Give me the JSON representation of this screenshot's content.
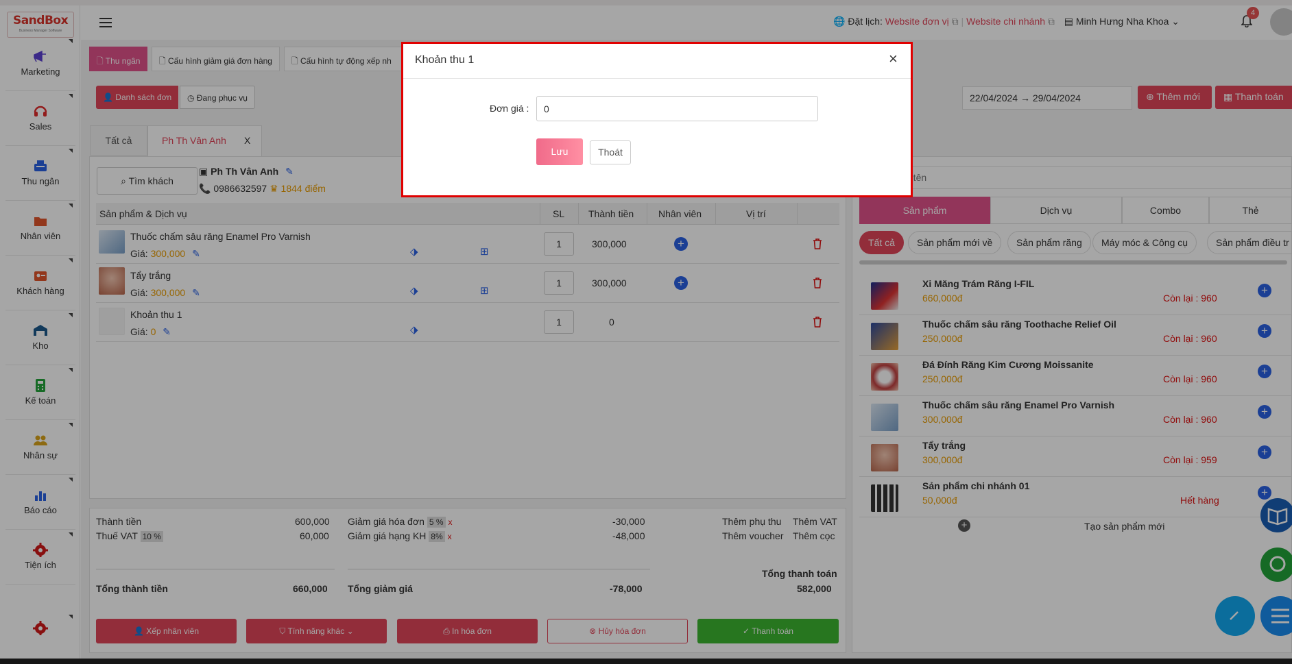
{
  "app": {
    "logo_main": "SandBox",
    "logo_sub": "Business Manager Software"
  },
  "sidebar": {
    "items": [
      {
        "label": "Marketing",
        "icon": "megaphone-icon",
        "color": "#5b3fd1"
      },
      {
        "label": "Sales",
        "icon": "headset-icon",
        "color": "#e02b2b"
      },
      {
        "label": "Thu ngân",
        "icon": "cash-register-icon",
        "color": "#2a61e4"
      },
      {
        "label": "Nhân viên",
        "icon": "folder-icon",
        "color": "#e0552b"
      },
      {
        "label": "Khách hàng",
        "icon": "contact-card-icon",
        "color": "#e0552b"
      },
      {
        "label": "Kho",
        "icon": "warehouse-icon",
        "color": "#1d5a8c"
      },
      {
        "label": "Kế toán",
        "icon": "calculator-icon",
        "color": "#22a33a"
      },
      {
        "label": "Nhân sự",
        "icon": "people-icon",
        "color": "#d9a31b"
      },
      {
        "label": "Báo cáo",
        "icon": "bar-chart-icon",
        "color": "#2a61e4"
      },
      {
        "label": "Tiện ích",
        "icon": "gear-icon",
        "color": "#d11a1a"
      }
    ]
  },
  "header": {
    "booking_label": "Đặt lịch:",
    "website_unit": "Website đơn vị",
    "website_branch": "Website chi nhánh",
    "branch_name": "Minh Hưng Nha Khoa",
    "notification_count": "4"
  },
  "tabs": {
    "cashier": "Thu ngân",
    "discount_config": "Cấu hình giảm giá đơn hàng",
    "auto_config": "Cấu hình tự động xếp nh"
  },
  "toolbar": {
    "order_list": "Danh sách đơn",
    "serving": "Đang phục vụ",
    "date_range": "22/04/2024 → 29/04/2024",
    "add_new": "Thêm mới",
    "pay": "Thanh toán"
  },
  "order_tabs": {
    "all": "Tất cả",
    "customer_tab": "Ph Th Vân Anh",
    "close": "X"
  },
  "customer": {
    "search_button": "Tìm khách",
    "name": "Ph Th Vân Anh",
    "phone": "0986632597",
    "points": "1844 điểm"
  },
  "order_table": {
    "headers": {
      "product": "Sản phẩm & Dịch vụ",
      "qty": "SL",
      "amount": "Thành tiền",
      "staff": "Nhân viên",
      "position": "Vị trí"
    },
    "price_prefix": "Giá:",
    "rows": [
      {
        "name": "Thuốc chấm sâu răng Enamel Pro Varnish",
        "price": "300,000",
        "qty": "1",
        "amount": "300,000"
      },
      {
        "name": "Tẩy trắng",
        "price": "300,000",
        "qty": "1",
        "amount": "300,000"
      },
      {
        "name": "Khoản thu 1",
        "price": "0",
        "qty": "1",
        "amount": "0"
      }
    ]
  },
  "summary": {
    "subtotal_label": "Thành tiền",
    "subtotal": "600,000",
    "vat_label": "Thuế VAT",
    "vat_rate": "10 %",
    "vat": "60,000",
    "invoice_discount_label": "Giảm giá hóa đơn",
    "invoice_discount_rate": "5 %",
    "invoice_discount": "-30,000",
    "rank_discount_label": "Giảm giá hạng KH",
    "rank_discount_rate": "8%",
    "rank_discount": "-48,000",
    "remove_mark": "x",
    "add_surcharge": "Thêm phụ thu",
    "add_vat": "Thêm VAT",
    "add_voucher": "Thêm voucher",
    "add_deposit": "Thêm cọc",
    "total_label": "Tổng thành tiền",
    "total": "660,000",
    "total_discount_label": "Tổng giảm giá",
    "total_discount": "-78,000",
    "grand_total_label": "Tổng thanh toán",
    "grand_total": "582,000"
  },
  "footer_buttons": {
    "assign_staff": "Xếp nhân viên",
    "other_features": "Tính năng khác",
    "print_invoice": "In hóa đơn",
    "cancel_invoice": "Hủy hóa đơn",
    "checkout": "Thanh toán"
  },
  "product_panel": {
    "search_placeholder": "o tên",
    "tabs": [
      "Sản phẩm",
      "Dịch vụ",
      "Combo",
      "Thẻ"
    ],
    "chips": [
      "Tất cả",
      "Sản phẩm mới về",
      "Sản phẩm răng",
      "Máy móc & Công cụ",
      "Sản phẩm điều tr"
    ],
    "stock_prefix": "Còn lại :",
    "products": [
      {
        "name": "Xi Măng Trám Răng I-FIL",
        "price": "660,000đ",
        "stock": "Còn lại : 960"
      },
      {
        "name": "Thuốc chấm sâu răng Toothache Relief Oil",
        "price": "250,000đ",
        "stock": "Còn lại : 960"
      },
      {
        "name": "Đá Đính Răng Kim Cương Moissanite",
        "price": "250,000đ",
        "stock": "Còn lại : 960"
      },
      {
        "name": "Thuốc chấm sâu răng Enamel Pro Varnish",
        "price": "300,000đ",
        "stock": "Còn lại : 960"
      },
      {
        "name": "Tẩy trắng",
        "price": "300,000đ",
        "stock": "Còn lại : 959"
      },
      {
        "name": "Sản phẩm chi nhánh 01",
        "price": "50,000đ",
        "stock": "Hết hàng"
      }
    ],
    "create_new": "Tạo sản phẩm mới"
  },
  "modal": {
    "title": "Khoản thu 1",
    "unit_price_label": "Đơn giá :",
    "unit_price_value": "0",
    "save": "Lưu",
    "exit": "Thoát"
  },
  "colors": {
    "accent": "#e0455a",
    "pink_gradient_start": "#f06b8a",
    "price": "#e89b00",
    "green": "#3cb531",
    "blue": "#2a61e4"
  }
}
